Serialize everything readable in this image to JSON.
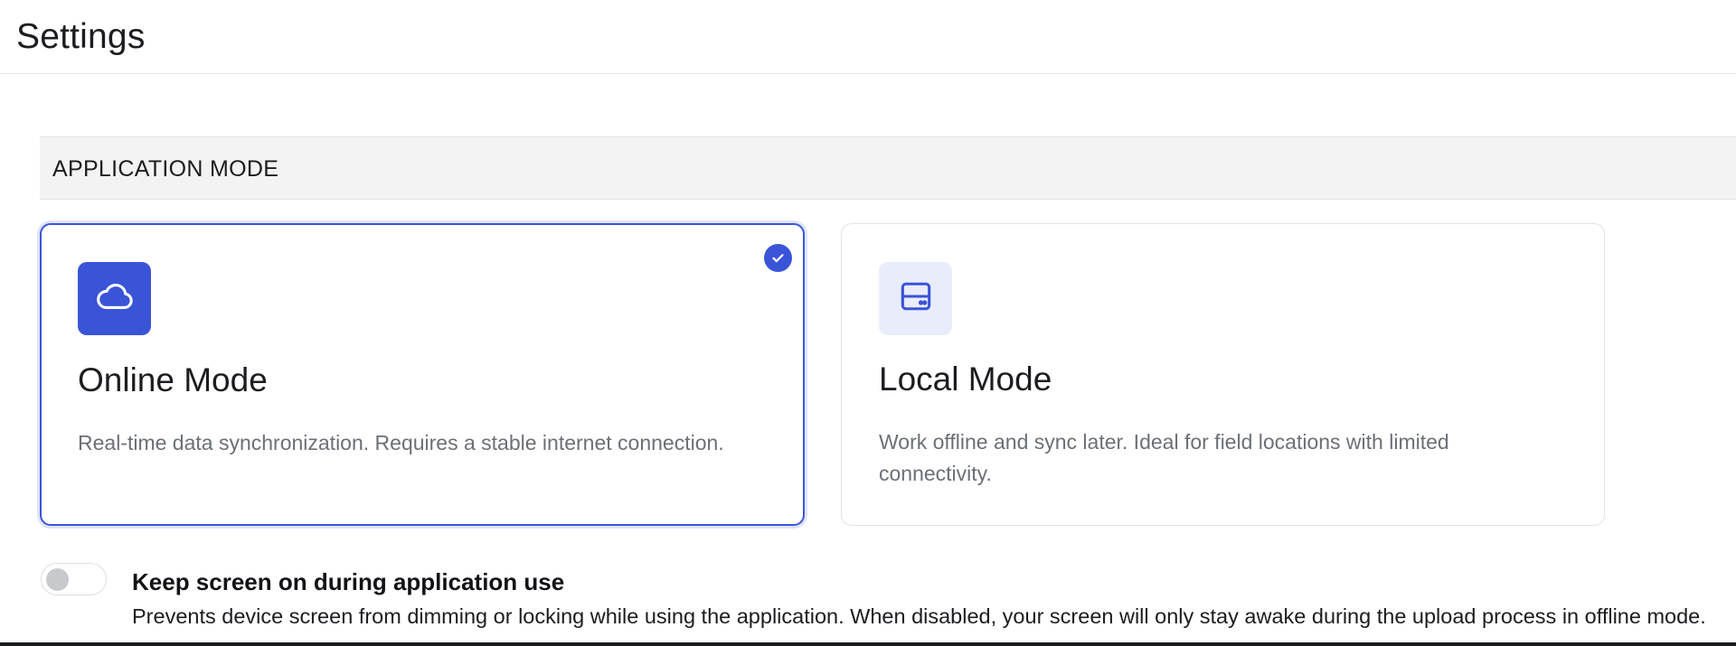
{
  "header": {
    "title": "Settings"
  },
  "section": {
    "title": "APPLICATION MODE"
  },
  "modes": [
    {
      "id": "online",
      "title": "Online Mode",
      "description": "Real-time data synchronization. Requires a stable internet connection.",
      "icon": "cloud-icon",
      "selected": true
    },
    {
      "id": "local",
      "title": "Local Mode",
      "description": "Work offline and sync later. Ideal for field locations with limited connectivity.",
      "icon": "hard-drive-icon",
      "selected": false
    }
  ],
  "keep_screen_on": {
    "label": "Keep screen on during application use",
    "description": "Prevents device screen from dimming or locking while using the application. When disabled, your screen will only stay awake during the upload process in offline mode.",
    "enabled": false
  },
  "colors": {
    "accent": "#3a54d8",
    "selected_border": "#3b55d9",
    "local_icon_bg": "#e9edfb",
    "muted_text": "#6b7077",
    "section_bg": "#f2f3f2"
  }
}
